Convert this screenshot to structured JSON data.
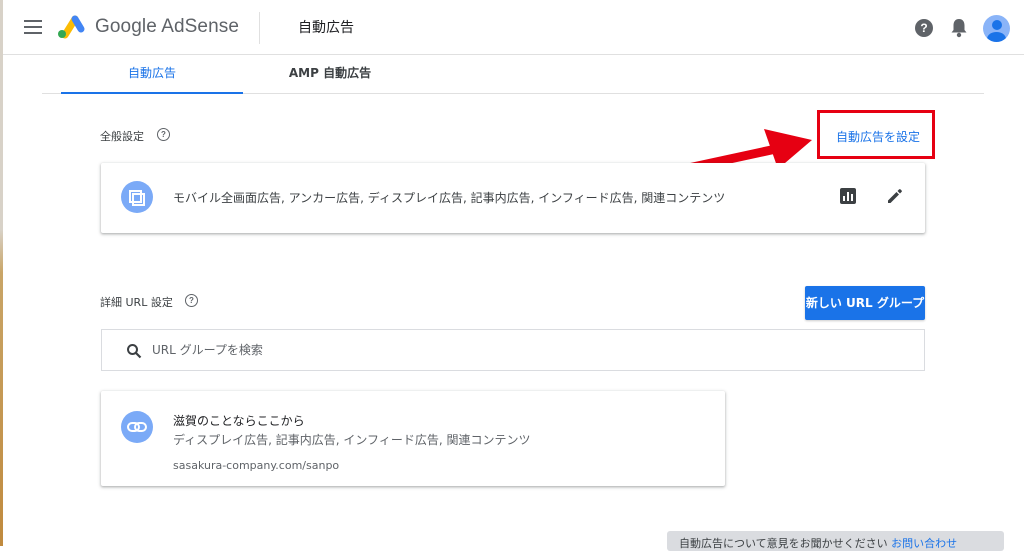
{
  "header": {
    "app_name": "Google AdSense",
    "page_title": "自動広告",
    "help_glyph": "?"
  },
  "tabs": [
    {
      "label": "自動広告",
      "active": true
    },
    {
      "label": "AMP 自動広告",
      "active": false
    }
  ],
  "general_settings": {
    "label": "全般設定",
    "help_glyph": "?",
    "configure_link": "自動広告を設定",
    "ad_formats": "モバイル全画面広告, アンカー広告, ディスプレイ広告, 記事内広告, インフィード広告, 関連コンテンツ"
  },
  "url_settings": {
    "label": "詳細 URL 設定",
    "help_glyph": "?",
    "new_group_button": "新しい URL グループ",
    "search_placeholder": "URL グループを検索"
  },
  "url_group": {
    "title": "滋賀のことならここから",
    "ad_formats": "ディスプレイ広告, 記事内広告, インフィード広告, 関連コンテンツ",
    "url": "sasakura-company.com/sanpo"
  },
  "snackbar": {
    "text": "自動広告について意見をお聞かせください",
    "link": "お問い合わせ"
  },
  "colors": {
    "accent": "#1a73e8",
    "annotation_red": "#e60012"
  },
  "icons": [
    "menu-icon",
    "adsense-logo",
    "help-icon",
    "bell-icon",
    "avatar",
    "mobile-screens-icon",
    "bar-chart-icon",
    "pencil-edit-icon",
    "search-icon",
    "link-icon"
  ]
}
